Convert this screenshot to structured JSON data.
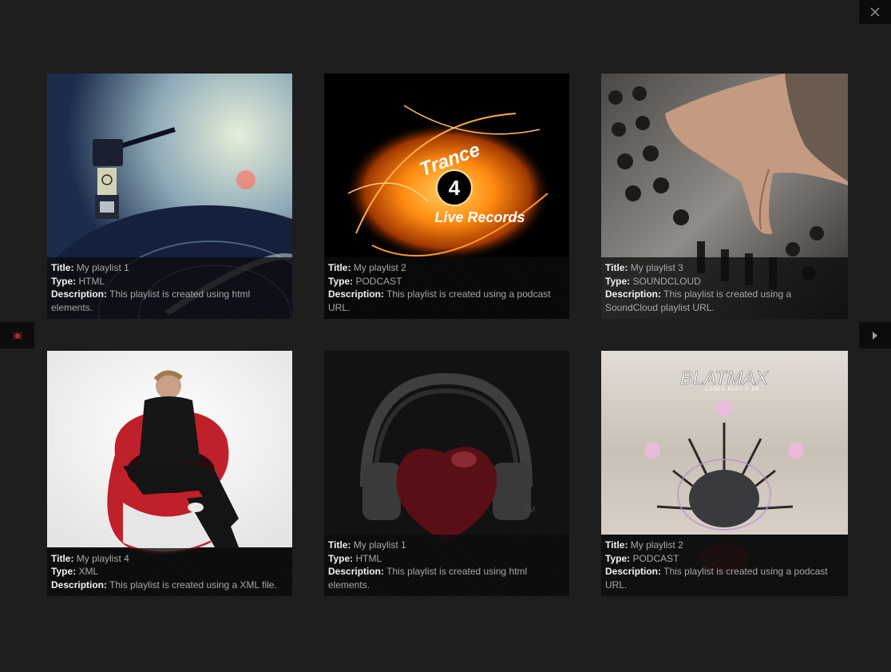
{
  "controls": {
    "close_icon": "close-icon",
    "prev_icon": "bug-icon",
    "next_icon": "play-arrow-icon"
  },
  "labels": {
    "title": "Title:",
    "type": "Type:",
    "description": "Description:"
  },
  "playlists": [
    {
      "title": "My playlist 1",
      "type": "HTML",
      "description": "This playlist is created using html elements.",
      "image": "turntable-stylus"
    },
    {
      "title": "My playlist 2",
      "type": "PODCAST",
      "description": "This playlist is created using a podcast URL.",
      "image": "trance-4-live-records-logo",
      "logo_text_1": "Trance",
      "logo_text_2": "4",
      "logo_text_3": "Live Records"
    },
    {
      "title": "My playlist 3",
      "type": "SOUNDCLOUD",
      "description": "This playlist is created using a SoundCloud playlist URL.",
      "image": "hand-on-mixer"
    },
    {
      "title": "My playlist 4",
      "type": "XML",
      "description": "This playlist is created using a XML file.",
      "image": "man-in-red-chair"
    },
    {
      "title": "My playlist 1",
      "type": "HTML",
      "description": "This playlist is created using html elements.",
      "image": "headphones-heart-logo"
    },
    {
      "title": "My playlist 2",
      "type": "PODCAST",
      "description": "This playlist is created using a podcast URL.",
      "image": "blatmax-album-cover",
      "logo_text_1": "BLATMAX",
      "logo_text_2": "CODEX PART II EP"
    }
  ]
}
